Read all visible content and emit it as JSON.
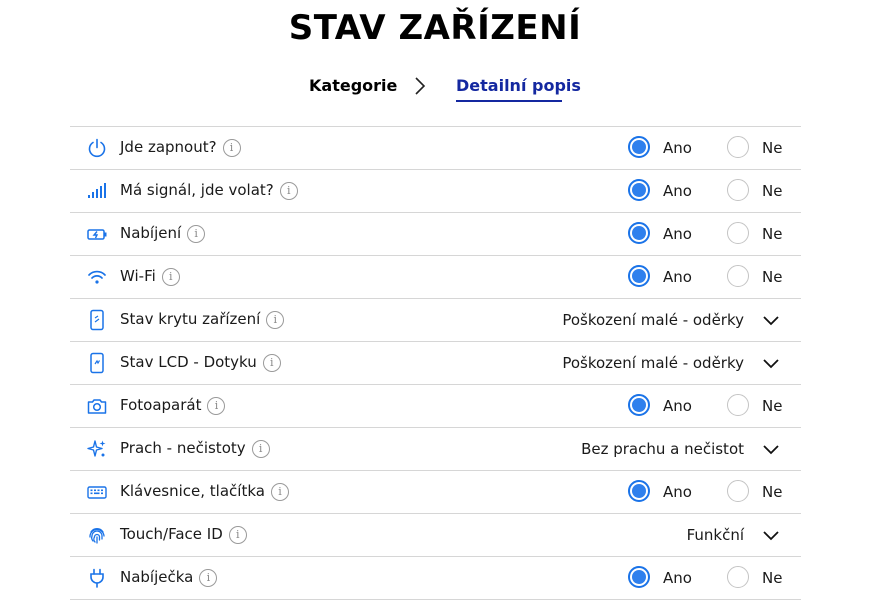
{
  "page": {
    "title": "STAV ZAŘÍZENÍ"
  },
  "breadcrumb": {
    "step1": "Kategorie",
    "step2": "Detailní popis"
  },
  "colors": {
    "accent": "#2f80ed",
    "active_step": "#1428a0",
    "icon": "#1a73e8"
  },
  "options": {
    "yes": "Ano",
    "no": "Ne"
  },
  "rows": [
    {
      "label": "Jde zapnout?",
      "icon": "power-icon",
      "type": "radio",
      "selected": "Ano"
    },
    {
      "label": "Má signál, jde volat?",
      "icon": "signal-icon",
      "type": "radio",
      "selected": "Ano"
    },
    {
      "label": "Nabíjení",
      "icon": "battery-charging-icon",
      "type": "radio",
      "selected": "Ano"
    },
    {
      "label": "Wi-Fi",
      "icon": "wifi-icon",
      "type": "radio",
      "selected": "Ano"
    },
    {
      "label": "Stav krytu zařízení",
      "icon": "phone-cover-icon",
      "type": "dropdown",
      "value": "Poškození malé - oděrky"
    },
    {
      "label": "Stav LCD - Dotyku",
      "icon": "phone-screen-icon",
      "type": "dropdown",
      "value": "Poškození malé - oděrky"
    },
    {
      "label": "Fotoaparát",
      "icon": "camera-icon",
      "type": "radio",
      "selected": "Ano"
    },
    {
      "label": "Prach - nečistoty",
      "icon": "sparkle-icon",
      "type": "dropdown",
      "value": "Bez prachu a nečistot"
    },
    {
      "label": "Klávesnice, tlačítka",
      "icon": "keyboard-icon",
      "type": "radio",
      "selected": "Ano"
    },
    {
      "label": "Touch/Face ID",
      "icon": "fingerprint-icon",
      "type": "dropdown",
      "value": "Funkční"
    },
    {
      "label": "Nabíječka",
      "icon": "charger-plug-icon",
      "type": "radio",
      "selected": "Ano"
    }
  ]
}
